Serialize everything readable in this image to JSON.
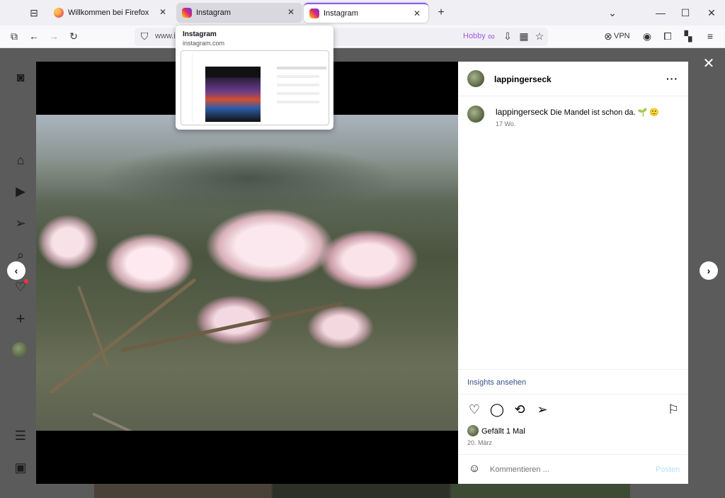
{
  "browser": {
    "tabs": [
      {
        "title": "Willkommen bei Firefox",
        "favicon": "firefox-icon"
      },
      {
        "title": "Instagram",
        "favicon": "instagram-icon"
      },
      {
        "title": "Instagram",
        "favicon": "instagram-icon"
      }
    ],
    "url_display": "www.i",
    "hobby_label": "Hobby",
    "vpn_label": "VPN"
  },
  "tab_preview": {
    "title": "Instagram",
    "url": "instagram.com"
  },
  "post": {
    "username": "lappingerseck",
    "caption_text": "Die Mandel ist schon da. 🌱 🙂",
    "caption_age": "17 Wo.",
    "insights_label": "Insights ansehen",
    "likes_label": "Gefällt 1 Mal",
    "date": "20. März",
    "comment_placeholder": "Kommentieren ...",
    "post_button": "Posten",
    "more_icon": "more-options-icon"
  },
  "colors": {
    "link_blue": "#385185",
    "post_disabled": "#b2dffc",
    "hobby_purple": "#a05ae0",
    "accent_active_tab": "#9059ff"
  }
}
